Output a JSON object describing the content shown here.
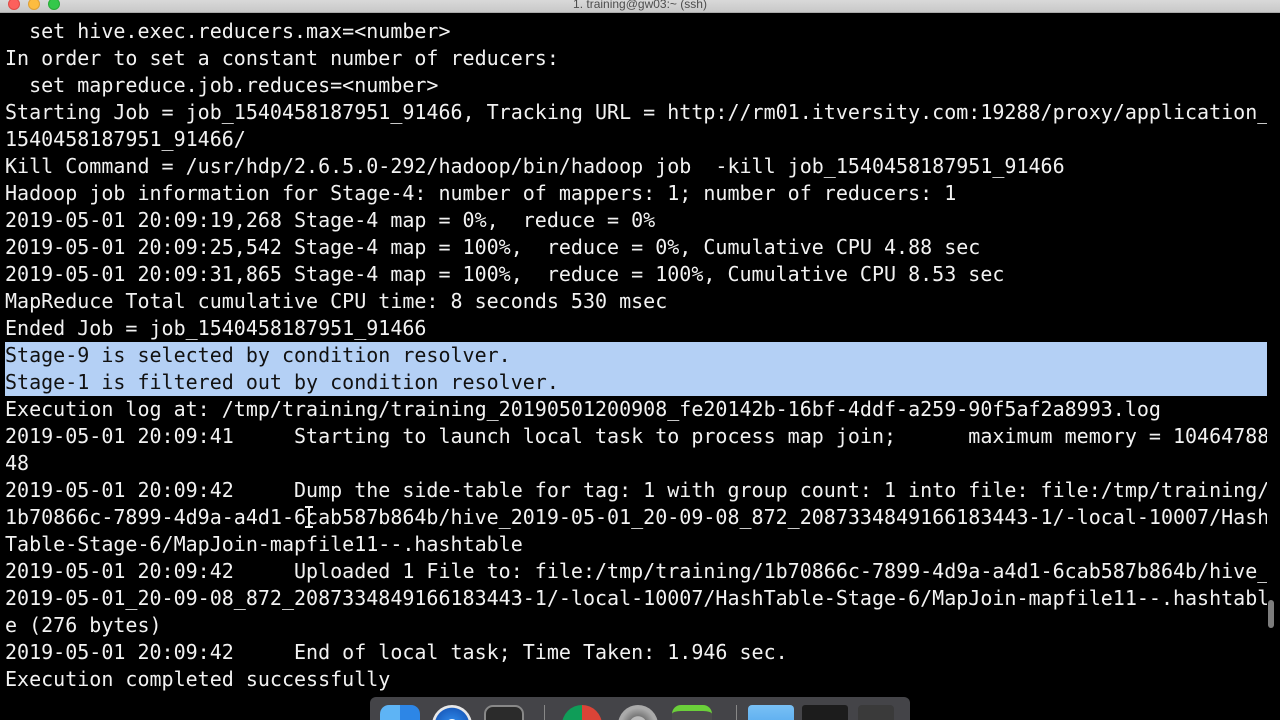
{
  "window": {
    "title": "1. training@gw03:~ (ssh)"
  },
  "terminal": {
    "lines": [
      {
        "text": "  set hive.exec.reducers.max=<number>",
        "selected": false
      },
      {
        "text": "In order to set a constant number of reducers:",
        "selected": false
      },
      {
        "text": "  set mapreduce.job.reduces=<number>",
        "selected": false
      },
      {
        "text": "Starting Job = job_1540458187951_91466, Tracking URL = http://rm01.itversity.com:19288/proxy/application_",
        "selected": false
      },
      {
        "text": "1540458187951_91466/",
        "selected": false
      },
      {
        "text": "Kill Command = /usr/hdp/2.6.5.0-292/hadoop/bin/hadoop job  -kill job_1540458187951_91466",
        "selected": false
      },
      {
        "text": "Hadoop job information for Stage-4: number of mappers: 1; number of reducers: 1",
        "selected": false
      },
      {
        "text": "2019-05-01 20:09:19,268 Stage-4 map = 0%,  reduce = 0%",
        "selected": false
      },
      {
        "text": "2019-05-01 20:09:25,542 Stage-4 map = 100%,  reduce = 0%, Cumulative CPU 4.88 sec",
        "selected": false
      },
      {
        "text": "2019-05-01 20:09:31,865 Stage-4 map = 100%,  reduce = 100%, Cumulative CPU 8.53 sec",
        "selected": false
      },
      {
        "text": "MapReduce Total cumulative CPU time: 8 seconds 530 msec",
        "selected": false
      },
      {
        "text": "Ended Job = job_1540458187951_91466",
        "selected": false
      },
      {
        "text": "Stage-9 is selected by condition resolver.",
        "selected": true
      },
      {
        "text": "Stage-1 is filtered out by condition resolver.",
        "selected": true
      },
      {
        "text": "Execution log at: /tmp/training/training_20190501200908_fe20142b-16bf-4ddf-a259-90f5af2a8993.log",
        "selected": false
      },
      {
        "text": "2019-05-01 20:09:41     Starting to launch local task to process map join;      maximum memory = 10464788",
        "selected": false
      },
      {
        "text": "48",
        "selected": false
      },
      {
        "text": "2019-05-01 20:09:42     Dump the side-table for tag: 1 with group count: 1 into file: file:/tmp/training/",
        "selected": false
      },
      {
        "text": "1b70866c-7899-4d9a-a4d1-6cab587b864b/hive_2019-05-01_20-09-08_872_2087334849166183443-1/-local-10007/Hash",
        "selected": false
      },
      {
        "text": "Table-Stage-6/MapJoin-mapfile11--.hashtable",
        "selected": false
      },
      {
        "text": "2019-05-01 20:09:42     Uploaded 1 File to: file:/tmp/training/1b70866c-7899-4d9a-a4d1-6cab587b864b/hive_",
        "selected": false
      },
      {
        "text": "2019-05-01_20-09-08_872_2087334849166183443-1/-local-10007/HashTable-Stage-6/MapJoin-mapfile11--.hashtabl",
        "selected": false
      },
      {
        "text": "e (276 bytes)",
        "selected": false
      },
      {
        "text": "2019-05-01 20:09:42     End of local task; Time Taken: 1.946 sec.",
        "selected": false
      },
      {
        "text": "Execution completed successfully",
        "selected": false
      }
    ]
  },
  "dock": {
    "icons": [
      "finder-icon",
      "safari-icon",
      "terminal-icon",
      "chrome-icon",
      "system-preferences-icon",
      "sublime-text-icon",
      "folder-icon",
      "display-icon",
      "trash-icon"
    ]
  }
}
